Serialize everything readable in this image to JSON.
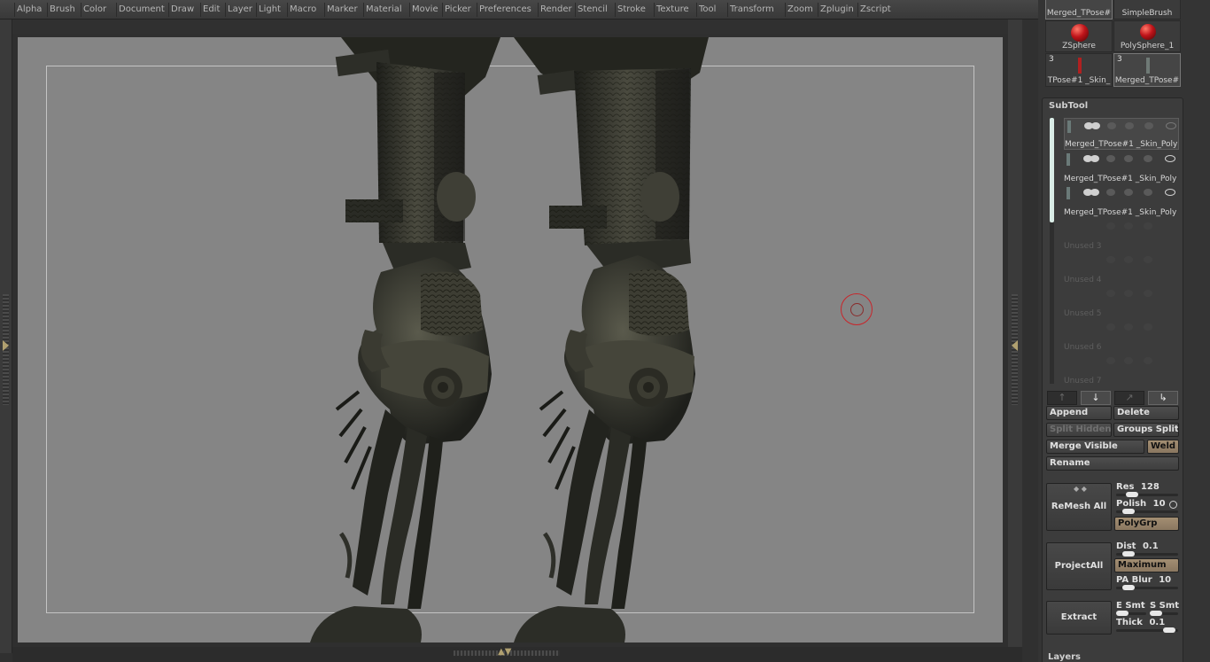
{
  "menu": [
    "Alpha",
    "Brush",
    "Color",
    "Document",
    "Draw",
    "Edit",
    "Layer",
    "Light",
    "Macro",
    "Marker",
    "Material",
    "Movie",
    "Picker",
    "Preferences",
    "Render",
    "Stencil",
    "Stroke",
    "Texture",
    "Tool",
    "Transform",
    "Zoom",
    "Zplugin",
    "Zscript"
  ],
  "tool_palette": {
    "items": [
      {
        "label": "Merged_TPose#",
        "count": ""
      },
      {
        "label": "SimpleBrush",
        "count": ""
      },
      {
        "label": "ZSphere",
        "count": ""
      },
      {
        "label": "PolySphere_1",
        "count": ""
      },
      {
        "label": "TPose#1 _Skin_",
        "count": "3"
      },
      {
        "label": "Merged_TPose#",
        "count": "3"
      }
    ]
  },
  "subtool": {
    "title": "SubTool",
    "rows": [
      {
        "label": "Merged_TPose#1 _Skin_Poly"
      },
      {
        "label": "Merged_TPose#1 _Skin_Poly"
      },
      {
        "label": "Merged_TPose#1 _Skin_Poly"
      },
      {
        "label": "Unused 3"
      },
      {
        "label": "Unused 4"
      },
      {
        "label": "Unused 5"
      },
      {
        "label": "Unused 6"
      },
      {
        "label": "Unused 7"
      }
    ],
    "nav": {
      "up": "↑",
      "down": "↓",
      "up_disabled": "↗",
      "down_alt": "↳"
    },
    "append": "Append",
    "delete": "Delete",
    "split_hidden": "Split Hidden",
    "groups_split": "Groups Split",
    "merge_visible": "Merge Visible",
    "weld": "Weld",
    "rename": "Rename",
    "remesh_all": "ReMesh All",
    "res_label": "Res",
    "res_value": "128",
    "res_level": 0.15,
    "polish_label": "Polish",
    "polish_value": "10",
    "polish_level": 0.1,
    "polygrp": "PolyGrp",
    "project_all": "ProjectAll",
    "dist_label": "Dist",
    "dist_value": "0.1",
    "dist_level": 0.1,
    "maximum": "Maximum",
    "pa_blur_label": "PA Blur",
    "pa_blur_value": "10",
    "pa_blur_level": 0.1,
    "extract": "Extract",
    "e_smt_label": "E Smt",
    "s_smt_label": "S Smt",
    "thick_label": "Thick",
    "thick_value": "0.1",
    "thick_level": 0.75
  },
  "layers_title": "Layers",
  "colors": {
    "canvas_bg": "#858585",
    "accent_tan": "#a38e72",
    "brush_cursor": "#c8252a",
    "model_dark": "#2a2c26"
  },
  "icons": [
    "brush-cursor-icon",
    "collapse-left-icon",
    "collapse-right-icon",
    "collapse-bottom-icon"
  ]
}
